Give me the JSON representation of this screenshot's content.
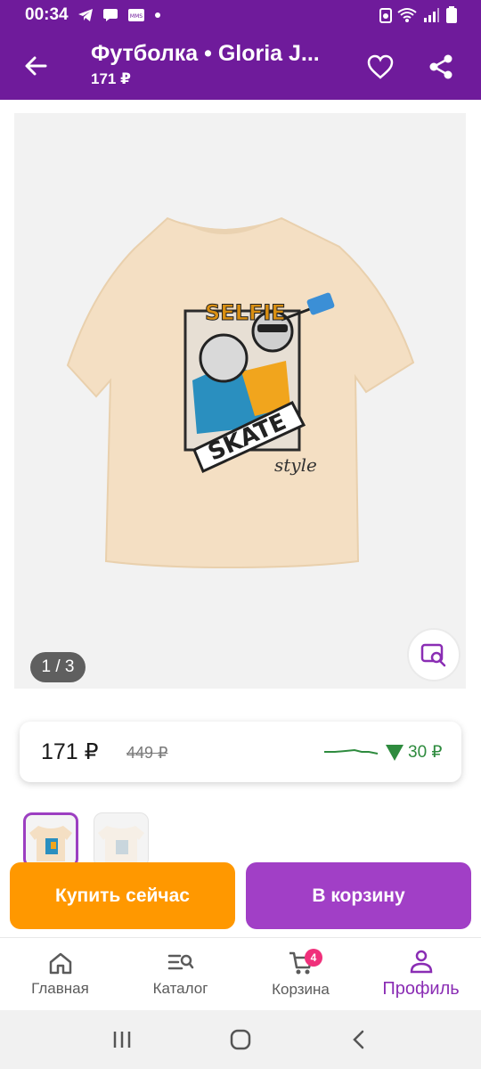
{
  "status_bar": {
    "time": "00:34",
    "icons": [
      "telegram-icon",
      "message-icon",
      "mms-icon",
      "dot-icon",
      "saver-icon",
      "wifi-icon",
      "signal-icon",
      "battery-icon"
    ]
  },
  "header": {
    "title": "Футболка • Gloria J...",
    "subtitle": "171 ₽"
  },
  "gallery": {
    "counter": "1 / 3",
    "graphic_text": {
      "line1": "SELFIE",
      "line2": "SKATE",
      "line3": "style"
    }
  },
  "price": {
    "current": "171 ₽",
    "old": "449 ₽",
    "drop": "30 ₽",
    "drop_color": "#2e8b3e"
  },
  "buttons": {
    "buy_now": "Купить сейчас",
    "add_to_cart": "В корзину"
  },
  "nav": {
    "items": [
      {
        "label": "Главная",
        "icon": "home-icon"
      },
      {
        "label": "Каталог",
        "icon": "catalog-search-icon"
      },
      {
        "label": "Корзина",
        "icon": "cart-icon",
        "badge": "4"
      },
      {
        "label": "Профиль",
        "icon": "profile-icon",
        "active": true
      }
    ]
  },
  "colors": {
    "brand": "#6f1b9b",
    "buy": "#ff9800",
    "cart": "#a13fc6",
    "active": "#8a2db4"
  }
}
